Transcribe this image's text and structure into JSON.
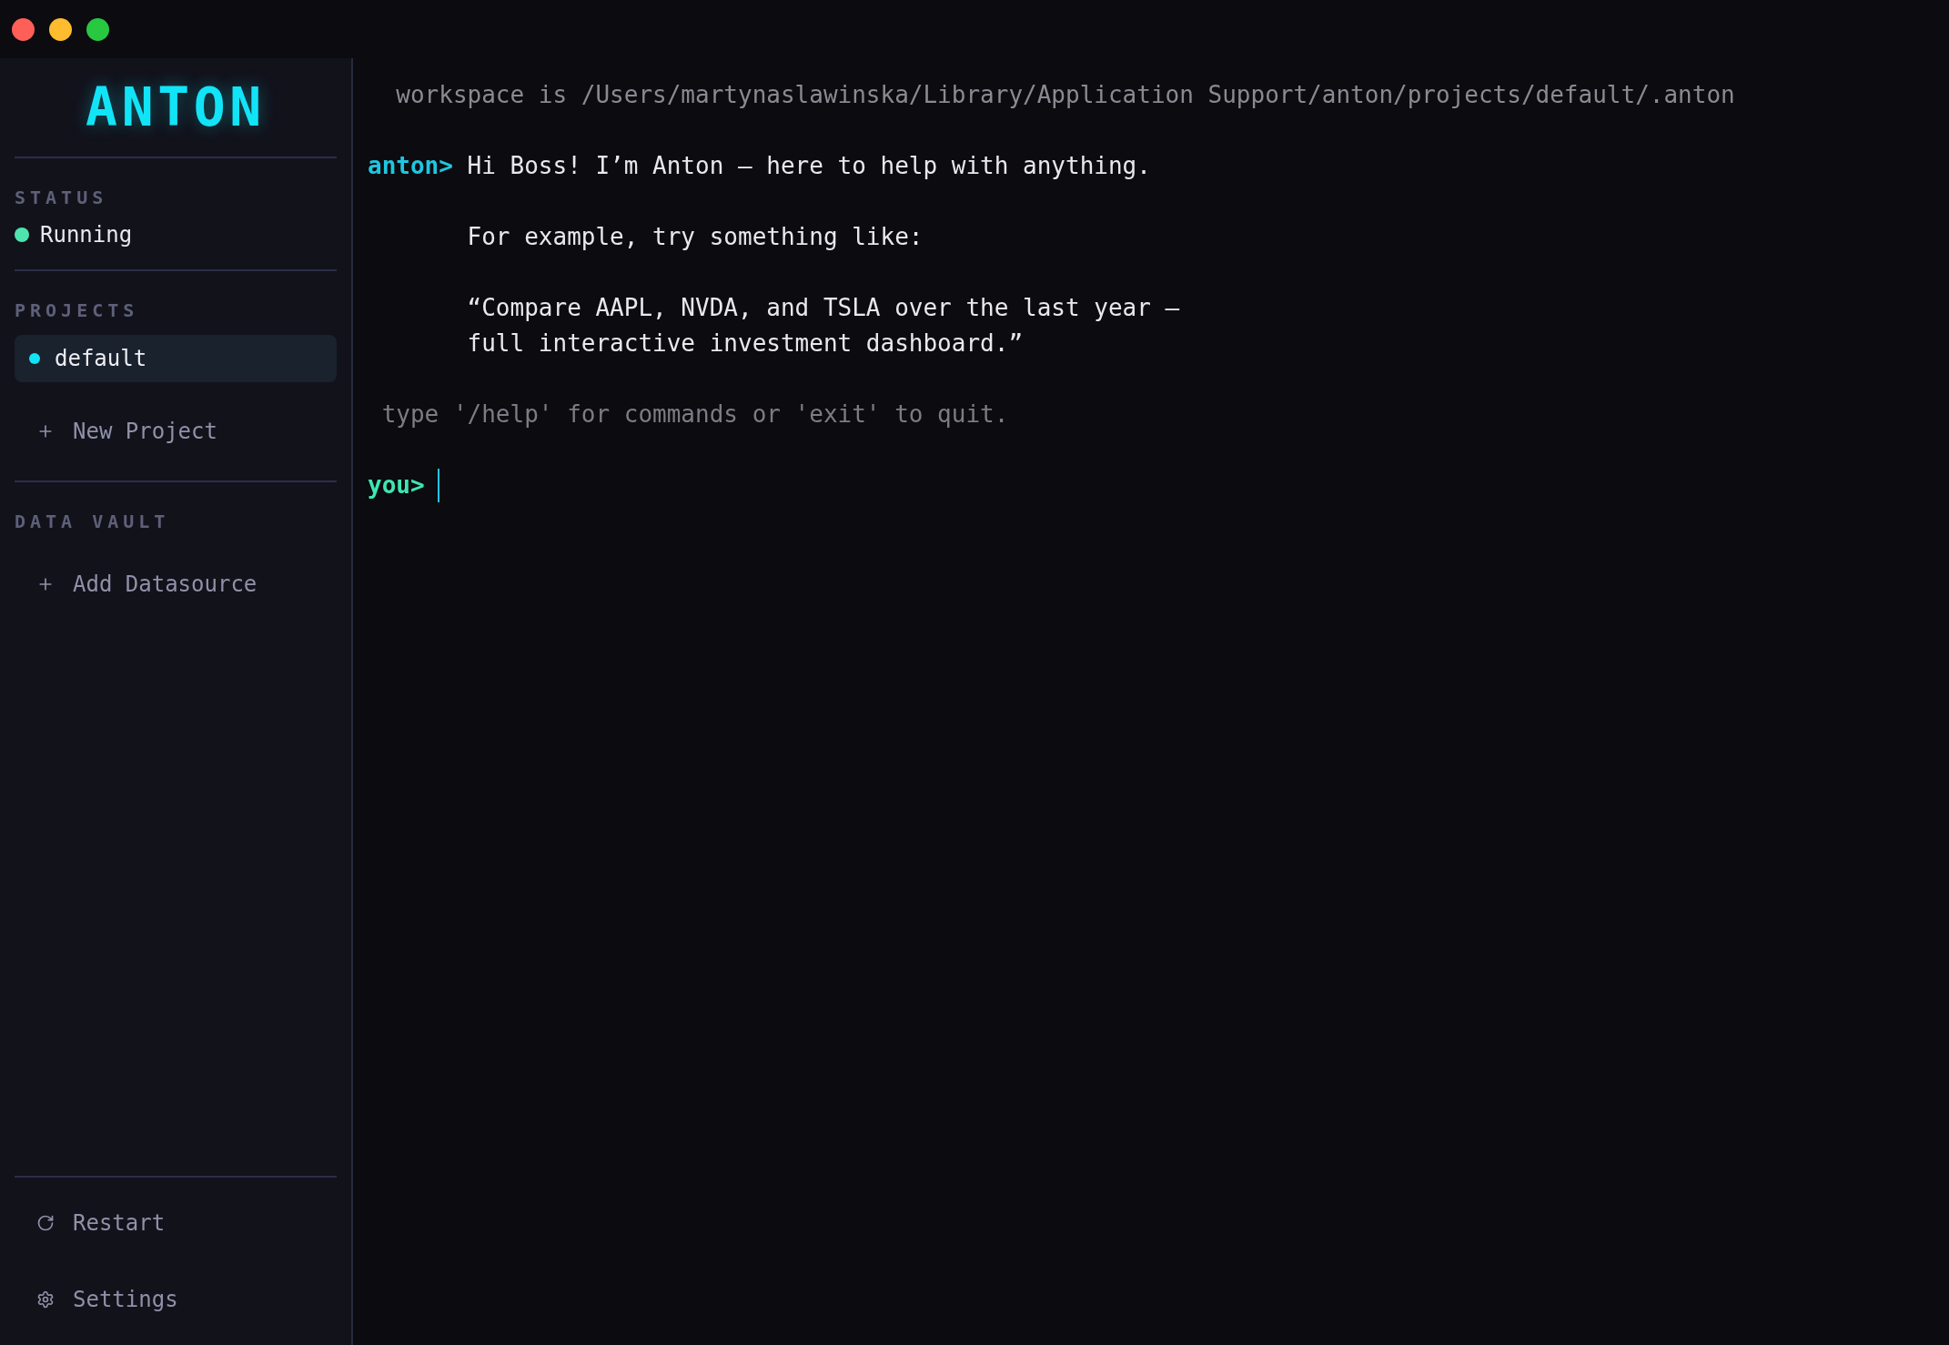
{
  "sidebar": {
    "logo": "ANTON",
    "status": {
      "label": "STATUS",
      "value": "Running",
      "color": "#4fe3ae"
    },
    "projects": {
      "label": "PROJECTS",
      "items": [
        {
          "name": "default",
          "selected": true
        }
      ],
      "add_button": "New Project"
    },
    "data_vault": {
      "label": "DATA VAULT",
      "add_button": "Add Datasource"
    },
    "footer": [
      {
        "kind": "restart",
        "label": "Restart"
      },
      {
        "kind": "settings",
        "label": "Settings"
      }
    ]
  },
  "terminal": {
    "blocks": [
      {
        "kind": "info",
        "lines": [
          "workspace is /Users/martynaslawinska/Library/Application Support/anton/projects/default/.anton"
        ]
      },
      {
        "kind": "message",
        "prompt": "anton>",
        "lines": [
          "Hi Boss! I’m Anton — here to help with anything."
        ]
      },
      {
        "kind": "continuation",
        "lines": [
          "For example, try something like:"
        ]
      },
      {
        "kind": "continuation",
        "lines": [
          "“Compare AAPL, NVDA, and TSLA over the last year —",
          "full interactive investment dashboard.”"
        ]
      },
      {
        "kind": "hint",
        "lines": [
          "type '/help' for commands or 'exit' to quit."
        ]
      }
    ],
    "input": {
      "prompt": "you>"
    }
  }
}
